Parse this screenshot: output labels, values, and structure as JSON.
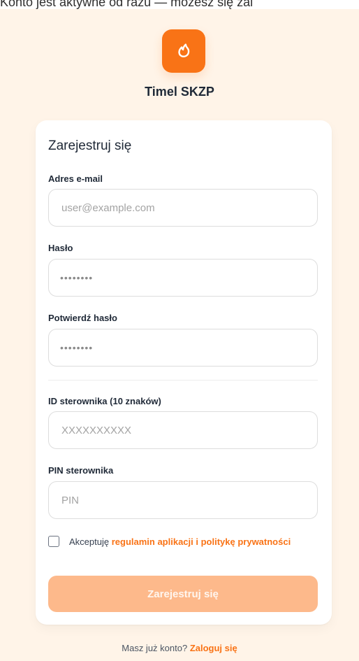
{
  "top_text": "Konto jest aktywne od razu — możesz się zal",
  "app": {
    "title": "Timel SKZP",
    "accent": "#f97316",
    "logo_icon": "flame-icon"
  },
  "card": {
    "title": "Zarejestruj się"
  },
  "fields": {
    "email": {
      "label": "Adres e-mail",
      "placeholder": "user@example.com"
    },
    "password": {
      "label": "Hasło",
      "value": "••••••••"
    },
    "confirm_password": {
      "label": "Potwierdź hasło",
      "value": "••••••••"
    },
    "controller_id": {
      "label": "ID sterownika (10 znaków)",
      "placeholder": "XXXXXXXXXX"
    },
    "controller_pin": {
      "label": "PIN sterownika",
      "placeholder": "PIN"
    }
  },
  "consent": {
    "prefix": "Akceptuję",
    "link_text": "regulamin aplikacji i politykę prywatności",
    "checked": false
  },
  "submit": {
    "label": "Zarejestruj się"
  },
  "footer": {
    "question": "Masz już konto?",
    "link": "Zaloguj się"
  }
}
